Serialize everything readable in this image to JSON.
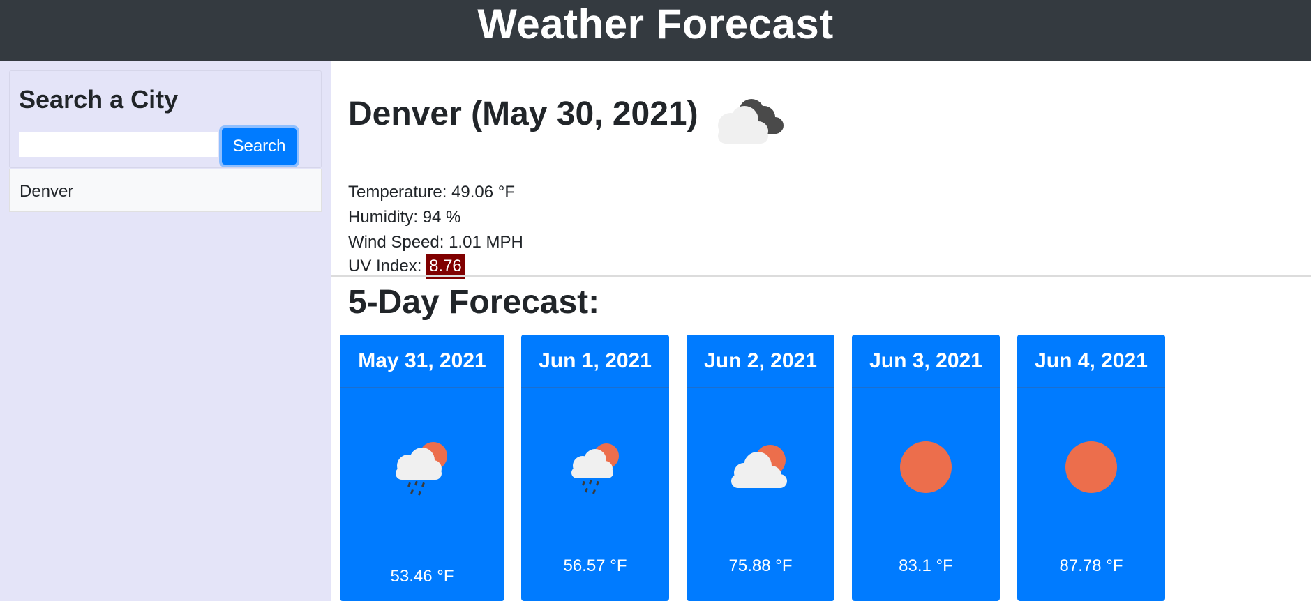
{
  "header": {
    "title": "Weather Forecast"
  },
  "sidebar": {
    "search_heading": "Search a City",
    "search_input": {
      "value": "",
      "placeholder": ""
    },
    "search_button_label": "Search",
    "history": [
      "Denver"
    ]
  },
  "current": {
    "title": "Denver (May 30, 2021)",
    "icon": "cloudy-night-icon",
    "temperature_label": "Temperature: 49.06 °F",
    "humidity_label": "Humidity: 94 %",
    "wind_label": "Wind Speed: 1.01 MPH",
    "uv_label": "UV Index:",
    "uv_value": "8.76",
    "uv_color": "#800000"
  },
  "forecast": {
    "title": "5-Day Forecast:",
    "card_color": "#007bff",
    "days": [
      {
        "date": "May 31, 2021",
        "icon": "rain-sun-icon",
        "temp": "53.46 °F"
      },
      {
        "date": "Jun 1, 2021",
        "icon": "rain-sun-icon",
        "temp": "56.57 °F"
      },
      {
        "date": "Jun 2, 2021",
        "icon": "partly-cloudy-icon",
        "temp": "75.88 °F"
      },
      {
        "date": "Jun 3, 2021",
        "icon": "sun-icon",
        "temp": "83.1 °F"
      },
      {
        "date": "Jun 4, 2021",
        "icon": "sun-icon",
        "temp": "87.78 °F"
      }
    ]
  }
}
